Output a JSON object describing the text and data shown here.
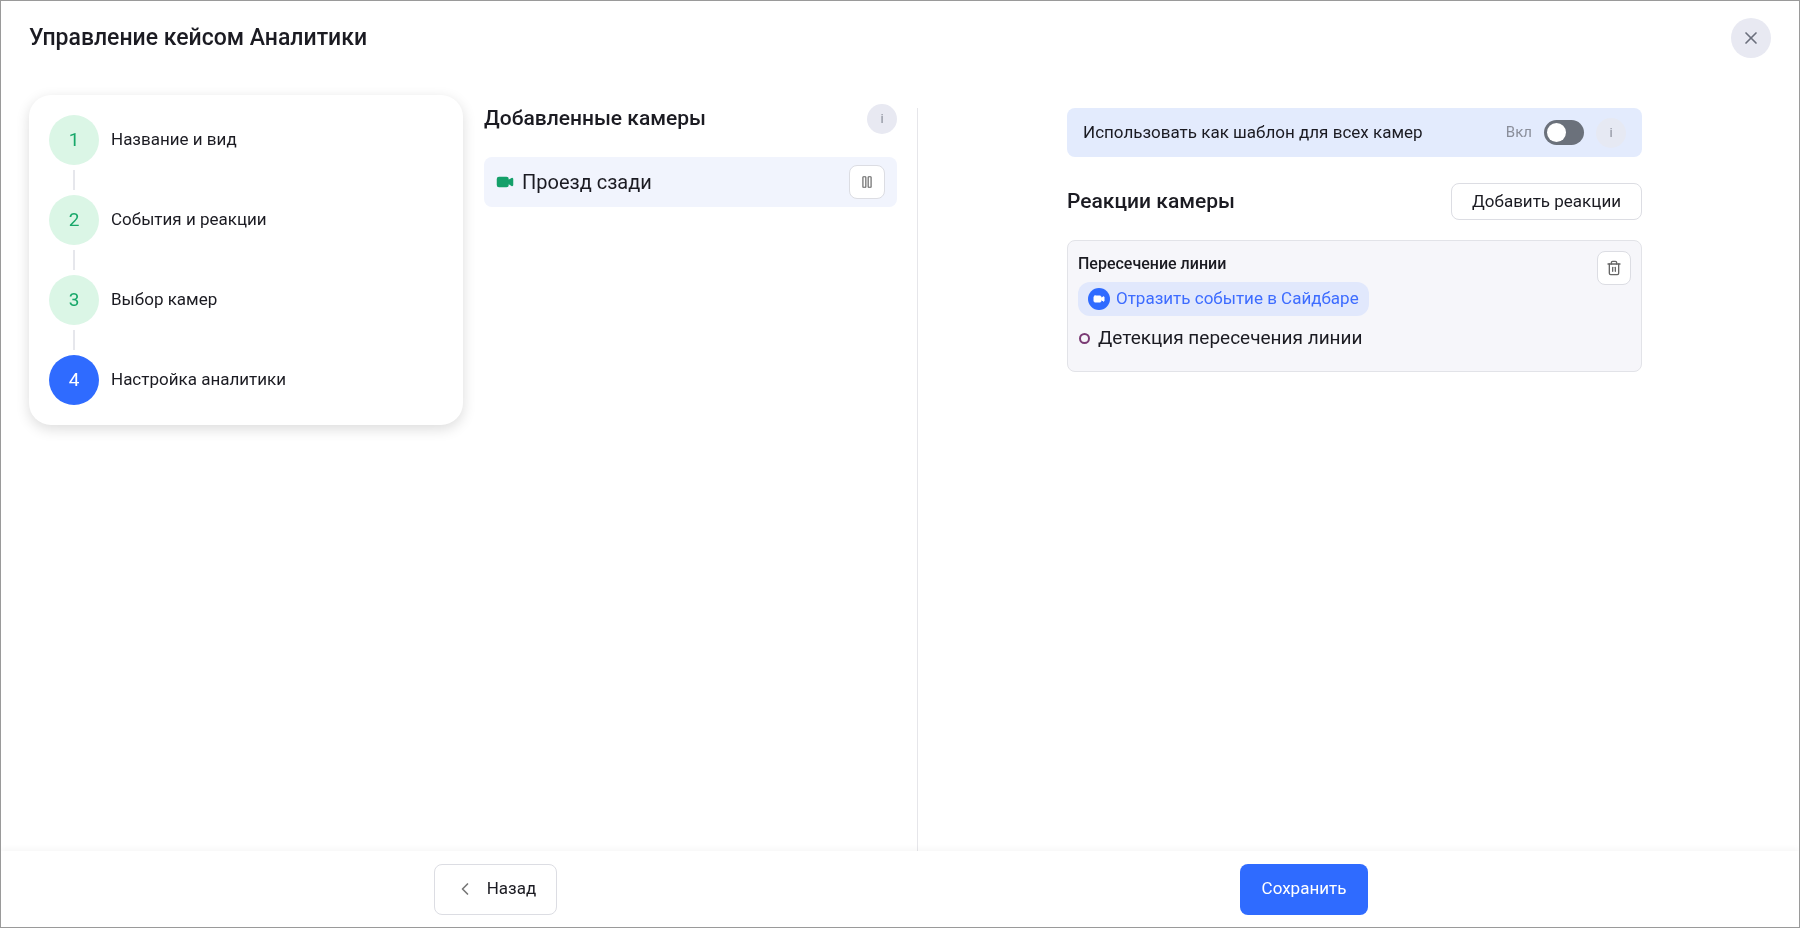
{
  "dialog": {
    "title": "Управление кейсом Аналитики"
  },
  "steps": [
    {
      "number": "1",
      "label": "Название и вид",
      "kind": "done"
    },
    {
      "number": "2",
      "label": "События и реакции",
      "kind": "done"
    },
    {
      "number": "3",
      "label": "Выбор камер",
      "kind": "done"
    },
    {
      "number": "4",
      "label": "Настройка аналитики",
      "kind": "current"
    }
  ],
  "cameras": {
    "title": "Добавленные камеры",
    "info": "i",
    "items": [
      {
        "name": "Проезд сзади",
        "selected": true
      }
    ]
  },
  "template": {
    "label": "Использовать как шаблон для всех камер",
    "toggle_label": "Вкл",
    "on": false,
    "info": "i"
  },
  "reactions": {
    "title": "Реакции камеры",
    "add_button": "Добавить реакции",
    "items": [
      {
        "title": "Пересечение линии",
        "action": "Отразить событие в Сайдбаре",
        "event": "Детекция пересечения линии"
      }
    ]
  },
  "footer": {
    "back": "Назад",
    "save": "Сохранить"
  }
}
